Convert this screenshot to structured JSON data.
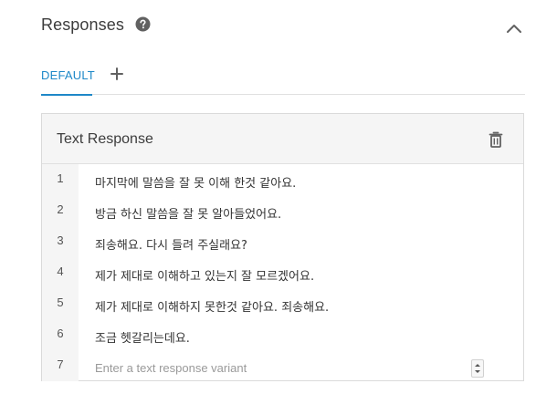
{
  "header": {
    "title": "Responses",
    "help_icon": "help-circle-icon",
    "collapse_icon": "chevron-up-icon"
  },
  "tabs": {
    "items": [
      {
        "label": "DEFAULT",
        "active": true
      }
    ],
    "add_icon": "plus-icon"
  },
  "card": {
    "title": "Text Response",
    "delete_icon": "trash-icon",
    "rows": [
      {
        "num": "1",
        "text": "마지막에 말씀을 잘 못 이해 한것 같아요."
      },
      {
        "num": "2",
        "text": "방금 하신 말씀을 잘 못 알아들었어요."
      },
      {
        "num": "3",
        "text": "죄송해요. 다시 들려 주실래요?"
      },
      {
        "num": "4",
        "text": "제가 제대로 이해하고 있는지 잘 모르겠어요."
      },
      {
        "num": "5",
        "text": "제가 제대로 이해하지 못한것 같아요. 죄송해요."
      },
      {
        "num": "6",
        "text": "조금 헷갈리는데요."
      }
    ],
    "new_row": {
      "num": "7",
      "placeholder": "Enter a text response variant",
      "value": ""
    }
  },
  "colors": {
    "accent": "#1e88c8",
    "header_bg": "#f5f5f5",
    "border": "#dadada",
    "icon": "#616161"
  }
}
